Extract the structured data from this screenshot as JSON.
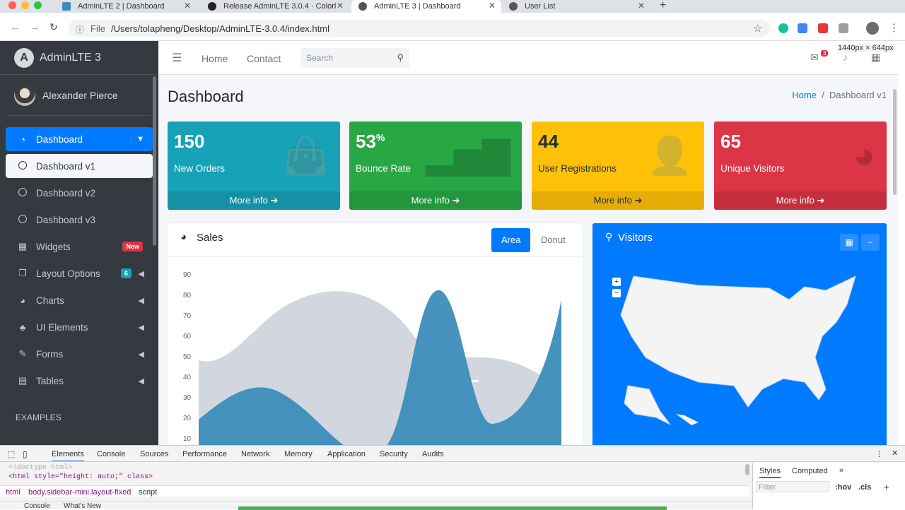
{
  "browser": {
    "tabs": [
      {
        "title": "AdminLTE 2 | Dashboard",
        "icon": "adminlte-icon"
      },
      {
        "title": "Release AdminLTE 3.0.4 · Colorl",
        "icon": "github-icon"
      },
      {
        "title": "AdminLTE 3 | Dashboard",
        "icon": "globe-icon"
      },
      {
        "title": "User List",
        "icon": "globe-icon"
      }
    ],
    "url_scheme": "File",
    "url": "/Users/tolapheng/Desktop/AdminLTE-3.0.4/index.html"
  },
  "sidebar": {
    "brand": "AdminLTE 3",
    "user": "Alexander Pierce",
    "items": [
      {
        "label": "Dashboard",
        "icon": "tachometer-icon"
      },
      {
        "label": "Dashboard v1",
        "icon": "circle-icon"
      },
      {
        "label": "Dashboard v2",
        "icon": "circle-icon"
      },
      {
        "label": "Dashboard v3",
        "icon": "circle-icon"
      },
      {
        "label": "Widgets",
        "icon": "th-icon",
        "badge": "New"
      },
      {
        "label": "Layout Options",
        "icon": "copy-icon",
        "badge": "6"
      },
      {
        "label": "Charts",
        "icon": "pie-chart-icon"
      },
      {
        "label": "UI Elements",
        "icon": "tree-icon"
      },
      {
        "label": "Forms",
        "icon": "edit-icon"
      },
      {
        "label": "Tables",
        "icon": "table-icon"
      }
    ],
    "section_header": "EXAMPLES"
  },
  "topnav": {
    "links": [
      "Home",
      "Contact"
    ],
    "search_placeholder": "Search",
    "dimension_overlay": "1440px × 644px",
    "notification_count": "3"
  },
  "page": {
    "title": "Dashboard",
    "breadcrumb": [
      "Home",
      "Dashboard v1"
    ]
  },
  "info_boxes": [
    {
      "value": "150",
      "sup": "",
      "label": "New Orders",
      "footer": "More info",
      "color": "#17a2b8",
      "icon": "shopping-bag-icon"
    },
    {
      "value": "53",
      "sup": "%",
      "label": "Bounce Rate",
      "footer": "More info",
      "color": "#28a745",
      "icon": "bar-chart-icon"
    },
    {
      "value": "44",
      "sup": "",
      "label": "User Registrations",
      "footer": "More info",
      "color": "#ffc107",
      "icon": "user-plus-icon"
    },
    {
      "value": "65",
      "sup": "",
      "label": "Unique Visitors",
      "footer": "More info",
      "color": "#dc3545",
      "icon": "pie-chart-icon"
    }
  ],
  "sales_card": {
    "title": "Sales",
    "tabs": [
      "Area",
      "Donut"
    ],
    "active_tab": "Area",
    "y_ticks": [
      "90",
      "80",
      "70",
      "60",
      "50",
      "40",
      "30",
      "20",
      "10"
    ]
  },
  "visitors_card": {
    "title": "Visitors",
    "zoom_in": "+",
    "zoom_out": "−"
  },
  "devtools": {
    "tabs": [
      "Elements",
      "Console",
      "Sources",
      "Performance",
      "Network",
      "Memory",
      "Application",
      "Security",
      "Audits"
    ],
    "code_line1": "<!doctype html>",
    "code_line2": "<html style=\"height: auto;\" class>",
    "crumbs": [
      "html",
      "body.sidebar-mini.layout-fixed",
      "script"
    ],
    "side_tabs": [
      "Styles",
      "Computed"
    ],
    "filter_placeholder": "Filter",
    "filter_hov": ":hov",
    "filter_cls": ".cls",
    "drawer_tabs": [
      "Console",
      "What's New"
    ]
  }
}
